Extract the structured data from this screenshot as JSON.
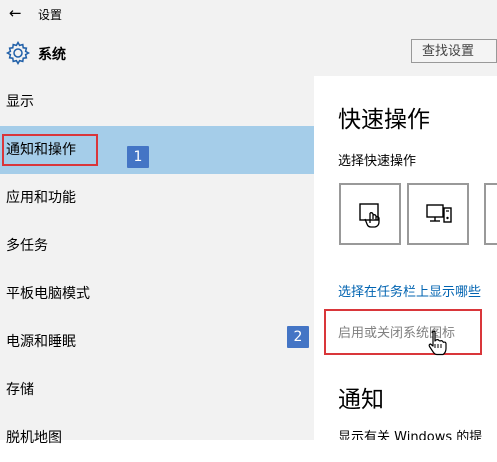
{
  "window": {
    "title": "设置",
    "back_icon": "back-arrow-icon"
  },
  "header": {
    "app_icon": "gear-icon",
    "app_name": "系统",
    "search_placeholder": "查找设置"
  },
  "sidebar": {
    "items": [
      {
        "label": "显示",
        "selected": false
      },
      {
        "label": "通知和操作",
        "selected": true
      },
      {
        "label": "应用和功能",
        "selected": false
      },
      {
        "label": "多任务",
        "selected": false
      },
      {
        "label": "平板电脑模式",
        "selected": false
      },
      {
        "label": "电源和睡眠",
        "selected": false
      },
      {
        "label": "存储",
        "selected": false
      },
      {
        "label": "脱机地图",
        "selected": false
      }
    ],
    "selected_color": "#a5cde9"
  },
  "annotations": {
    "badge1": "1",
    "badge2": "2",
    "highlight_color": "#d9363a",
    "badge_color": "#4475c5"
  },
  "content": {
    "quick_actions_title": "快速操作",
    "quick_actions_subtitle": "选择快速操作",
    "tiles": [
      {
        "icon": "tablet-mode-icon"
      },
      {
        "icon": "project-icon"
      },
      {
        "icon": "tile-icon"
      }
    ],
    "taskbar_link": "选择在任务栏上显示哪些",
    "system_icons_link": "启用或关闭系统图标",
    "notifications_title": "通知",
    "notifications_text": "显示有关 Windows 的提",
    "link_color": "#0063b1"
  }
}
